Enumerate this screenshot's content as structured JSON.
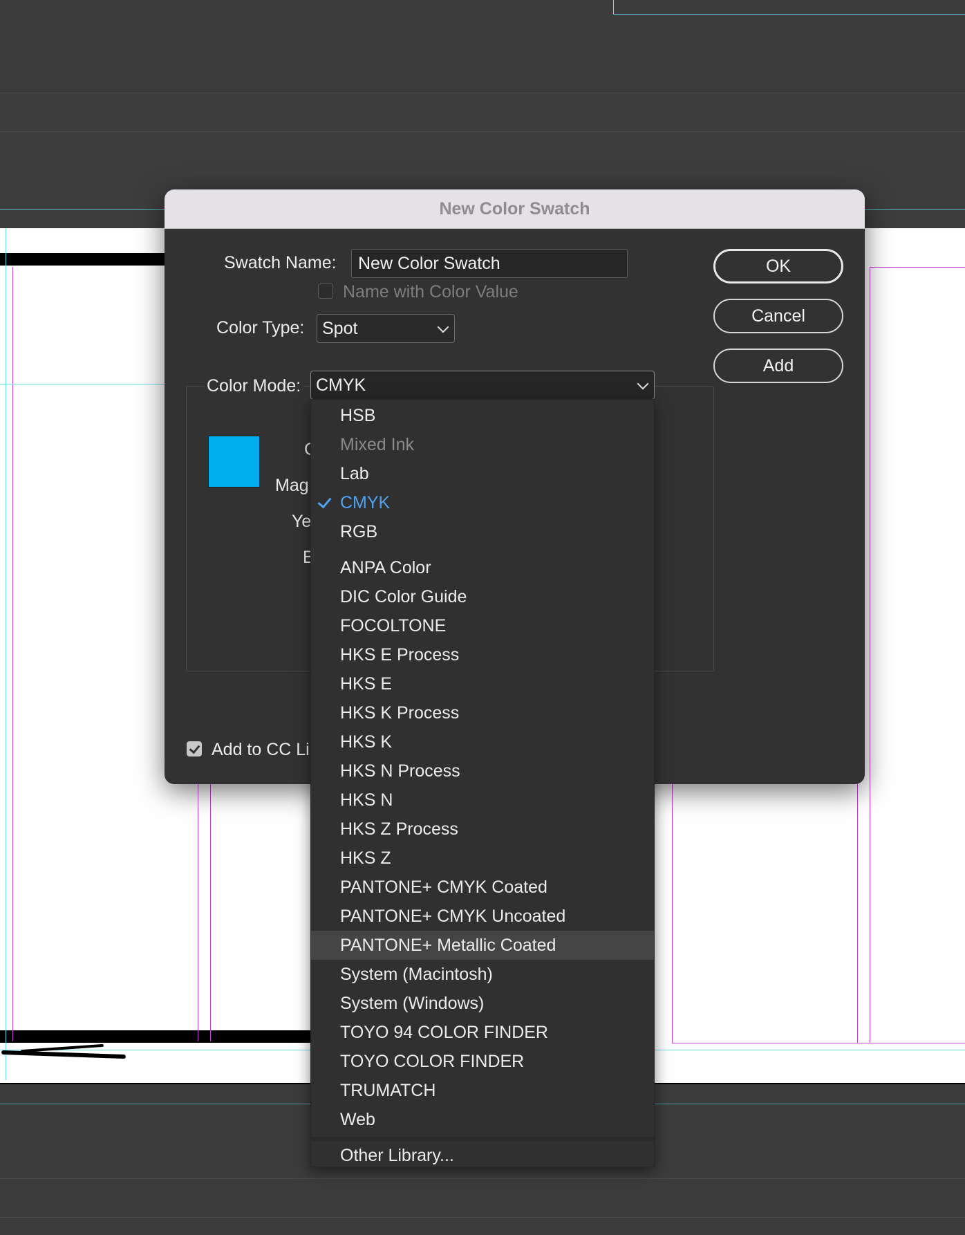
{
  "dialog": {
    "title": "New Color Swatch",
    "swatch_name_label": "Swatch Name:",
    "swatch_name_value": "New Color Swatch",
    "name_with_color_value_label": "Name with Color Value",
    "color_type_label": "Color Type:",
    "color_type_value": "Spot",
    "color_mode_label": "Color Mode:",
    "color_mode_value": "CMYK",
    "add_to_cc_label": "Add to CC Li",
    "swatch_color": "#00aeef",
    "partial_labels": {
      "cyan": "C",
      "magenta": "Mag",
      "yellow": "Ye",
      "black": "B"
    },
    "buttons": {
      "ok": "OK",
      "cancel": "Cancel",
      "add": "Add"
    }
  },
  "color_mode_menu": {
    "items": [
      {
        "label": "HSB"
      },
      {
        "label": "Mixed Ink"
      },
      {
        "label": "Lab"
      },
      {
        "label": "CMYK"
      },
      {
        "label": "RGB"
      },
      {
        "label": "ANPA Color"
      },
      {
        "label": "DIC Color Guide"
      },
      {
        "label": "FOCOLTONE"
      },
      {
        "label": "HKS E Process"
      },
      {
        "label": "HKS E"
      },
      {
        "label": "HKS K Process"
      },
      {
        "label": "HKS K"
      },
      {
        "label": "HKS N Process"
      },
      {
        "label": "HKS N"
      },
      {
        "label": "HKS Z Process"
      },
      {
        "label": "HKS Z"
      },
      {
        "label": "PANTONE+ CMYK Coated"
      },
      {
        "label": "PANTONE+ CMYK Uncoated"
      },
      {
        "label": "PANTONE+ Metallic Coated"
      },
      {
        "label": "System (Macintosh)"
      },
      {
        "label": "System (Windows)"
      },
      {
        "label": "TOYO 94 COLOR FINDER"
      },
      {
        "label": "TOYO COLOR FINDER"
      },
      {
        "label": "TRUMATCH"
      },
      {
        "label": "Web"
      },
      {
        "label": "Other Library..."
      }
    ]
  },
  "colors": {
    "accent_selected": "#4ea2f0",
    "guide_cyan": "#5fe0ea",
    "guide_magenta": "#c040d0"
  }
}
